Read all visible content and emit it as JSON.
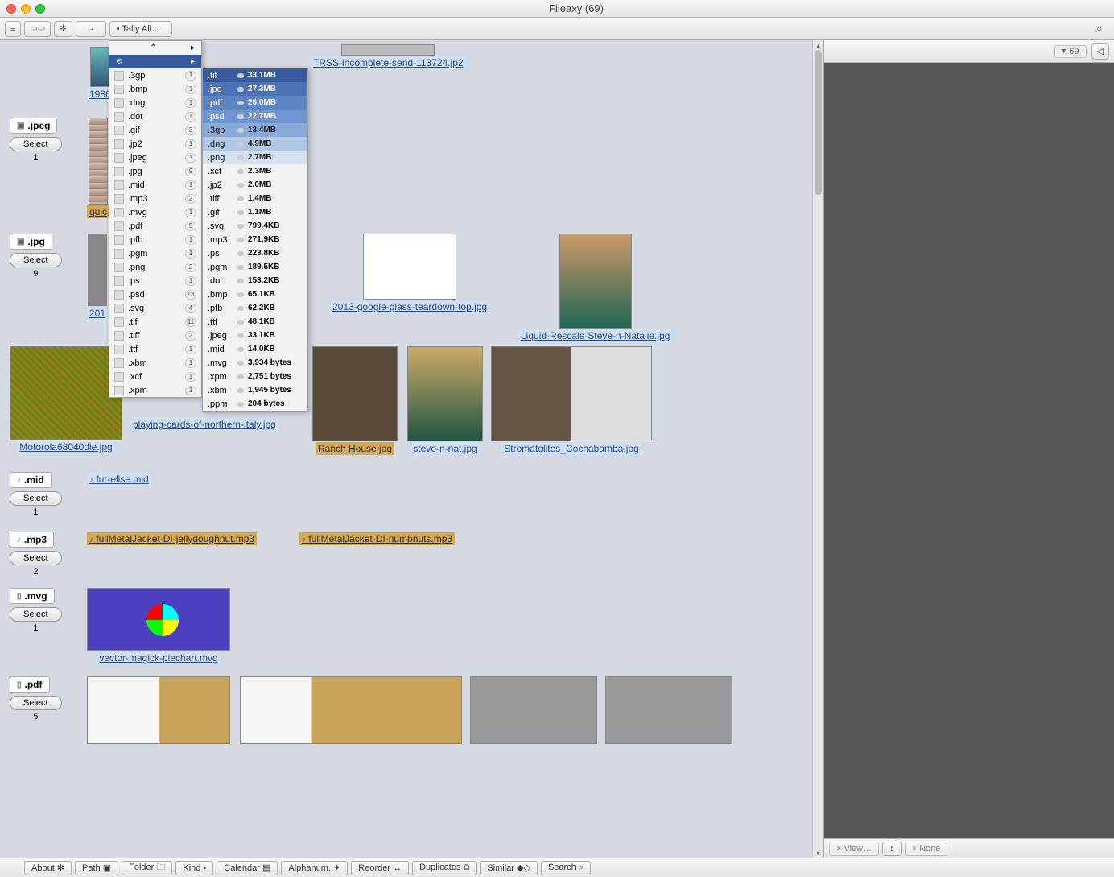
{
  "window": {
    "title": "Fileaxy  (69)"
  },
  "toolbar": {
    "menu": "≡",
    "tally": "•  Tally All…",
    "search_icon": "⌕"
  },
  "right_header": {
    "count": "69"
  },
  "right_footer": {
    "view": "×  View…",
    "updown": "↕",
    "none": "×  None"
  },
  "statusbar": {
    "about": "About ✻",
    "path": "Path ▣",
    "folder": "Folder 🗀",
    "kind": "Kind •",
    "calendar": "Calendar ▤",
    "alphanum": "Alphanum. ✦",
    "reorder": "Reorder ↔",
    "duplicates": "Duplicates ⧉",
    "similar": "Similar ◆◇",
    "search": "Search ⌕"
  },
  "groups": [
    {
      "ext": ".jpeg",
      "select": "Select",
      "count": "1"
    },
    {
      "ext": ".jpg",
      "select": "Select",
      "count": "9"
    },
    {
      "ext": ".mid",
      "select": "Select",
      "count": "1"
    },
    {
      "ext": ".mp3",
      "select": "Select",
      "count": "2"
    },
    {
      "ext": ".mvg",
      "select": "Select",
      "count": "1"
    },
    {
      "ext": ".pdf",
      "select": "Select",
      "count": "5"
    }
  ],
  "thumbs": {
    "y1986": "1986",
    "trss": "TRSS-incomplete-send-113724.jp2",
    "quic": "quic",
    "y201": "201",
    "google": "2013-google-glass-teardown-top.jpg",
    "liquid": "Liquid-Rescale-Steve-n-Natalie.jpg",
    "motorola": "Motorola68040die.jpg",
    "cards": "playing-cards-of-northern-italy.jpg",
    "ranch": "Ranch House.jpg",
    "steve": "steve-n-nat.jpg",
    "stroma": "Stromatolites_Cochabamba.jpg",
    "furelise": "fur-elise.mid",
    "fmj1": "fullMetalJacket-DI-jellydoughnut.mp3",
    "fmj2": "fullMetalJacket-DI-numbnuts.mp3",
    "vector": "vector-magick-piechart.mvg"
  },
  "ext_menu": [
    {
      "ext": ".3gp",
      "count": "1"
    },
    {
      "ext": ".bmp",
      "count": "1"
    },
    {
      "ext": ".dng",
      "count": "1"
    },
    {
      "ext": ".dot",
      "count": "1"
    },
    {
      "ext": ".gif",
      "count": "3"
    },
    {
      "ext": ".jp2",
      "count": "1"
    },
    {
      "ext": ".jpeg",
      "count": "1"
    },
    {
      "ext": ".jpg",
      "count": "9"
    },
    {
      "ext": ".mid",
      "count": "1"
    },
    {
      "ext": ".mp3",
      "count": "2"
    },
    {
      "ext": ".mvg",
      "count": "1"
    },
    {
      "ext": ".pdf",
      "count": "5"
    },
    {
      "ext": ".pfb",
      "count": "1"
    },
    {
      "ext": ".pgm",
      "count": "1"
    },
    {
      "ext": ".png",
      "count": "2"
    },
    {
      "ext": ".ps",
      "count": "1"
    },
    {
      "ext": ".psd",
      "count": "13"
    },
    {
      "ext": ".svg",
      "count": "4"
    },
    {
      "ext": ".tif",
      "count": "11"
    },
    {
      "ext": ".tiff",
      "count": "2"
    },
    {
      "ext": ".ttf",
      "count": "1"
    },
    {
      "ext": ".xbm",
      "count": "1"
    },
    {
      "ext": ".xcf",
      "count": "1"
    },
    {
      "ext": ".xpm",
      "count": "1"
    }
  ],
  "size_menu": [
    {
      "ext": ".tif",
      "size": "33.1MB",
      "hl": 0
    },
    {
      "ext": ".jpg",
      "size": "27.3MB",
      "hl": 1
    },
    {
      "ext": ".pdf",
      "size": "26.0MB",
      "hl": 2
    },
    {
      "ext": ".psd",
      "size": "22.7MB",
      "hl": 3
    },
    {
      "ext": ".3gp",
      "size": "13.4MB",
      "hl": 4
    },
    {
      "ext": ".dng",
      "size": "4.9MB",
      "hl": 5
    },
    {
      "ext": ".png",
      "size": "2.7MB",
      "hl": 6
    },
    {
      "ext": ".xcf",
      "size": "2.3MB",
      "hl": -1
    },
    {
      "ext": ".jp2",
      "size": "2.0MB",
      "hl": -1
    },
    {
      "ext": ".tiff",
      "size": "1.4MB",
      "hl": -1
    },
    {
      "ext": ".gif",
      "size": "1.1MB",
      "hl": -1
    },
    {
      "ext": ".svg",
      "size": "799.4KB",
      "hl": -1
    },
    {
      "ext": ".mp3",
      "size": "271.9KB",
      "hl": -1
    },
    {
      "ext": ".ps",
      "size": "223.8KB",
      "hl": -1
    },
    {
      "ext": ".pgm",
      "size": "189.5KB",
      "hl": -1
    },
    {
      "ext": ".dot",
      "size": "153.2KB",
      "hl": -1
    },
    {
      "ext": ".bmp",
      "size": "65.1KB",
      "hl": -1
    },
    {
      "ext": ".pfb",
      "size": "62.2KB",
      "hl": -1
    },
    {
      "ext": ".ttf",
      "size": "48.1KB",
      "hl": -1
    },
    {
      "ext": ".jpeg",
      "size": "33.1KB",
      "hl": -1
    },
    {
      "ext": ".mid",
      "size": "14.0KB",
      "hl": -1
    },
    {
      "ext": ".mvg",
      "size": "3,934 bytes",
      "hl": -1
    },
    {
      "ext": ".xpm",
      "size": "2,751 bytes",
      "hl": -1
    },
    {
      "ext": ".xbm",
      "size": "1,945 bytes",
      "hl": -1
    },
    {
      "ext": ".ppm",
      "size": "204 bytes",
      "hl": -1
    }
  ]
}
